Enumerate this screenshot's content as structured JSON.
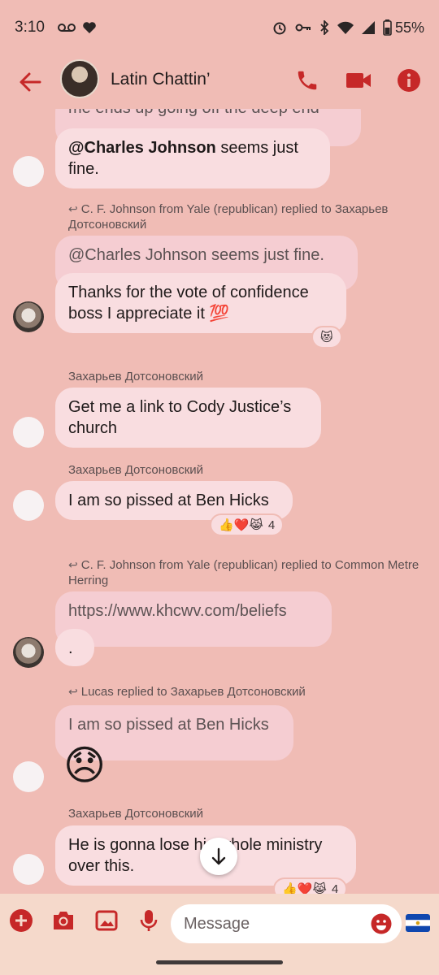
{
  "status": {
    "time": "3:10",
    "battery": "55%",
    "icons": [
      "voicemail-icon",
      "heart-icon",
      "alarm-icon",
      "vpn-key-icon",
      "bluetooth-icon",
      "wifi-icon",
      "signal-icon",
      "battery-icon"
    ]
  },
  "header": {
    "title": "Latin Chattin’",
    "icons": [
      "back-arrow-icon",
      "phone-icon",
      "video-camera-icon",
      "info-icon"
    ],
    "accent": "#c62828"
  },
  "messages": {
    "m1_partial": "me ends up going off the deep end",
    "m2_mention": "@Charles Johnson",
    "m2_rest": " seems just fine.",
    "reply1_label": "C. F. Johnson from Yale (republican) replied to Захарьев Дотсоновский",
    "reply1_quote": "@Charles Johnson  seems just fine.",
    "reply1_text": "Thanks for the vote of confidence boss I appreciate it 💯",
    "reply1_reaction": "😻",
    "sender2": "Захарьев Дотсоновский",
    "m3_text": "Get me a link to Cody Justice’s church",
    "sender3": "Захарьев Дотсоновский",
    "m4_text": "I am so pissed at Ben Hicks",
    "m4_reactions": "👍❤️😹",
    "m4_reaction_count": "4",
    "reply2_label": "C. F. Johnson from Yale (republican) replied to Common Metre Herring",
    "reply2_quote": "https://www.khcwv.com/beliefs",
    "reply2_text": ".",
    "reply3_label": "Lucas replied to Захарьев Дотсоновский",
    "reply3_quote": "I am so pissed at Ben Hicks",
    "reply3_emoji": "😞",
    "sender4": "Захарьев Дотсоновский",
    "m5_text": "He is gonna lose his whole ministry over this.",
    "m5_reactions": "👍❤️😹",
    "m5_reaction_count": "4"
  },
  "compose": {
    "placeholder": "Message",
    "icons": [
      "add-icon",
      "camera-icon",
      "gallery-icon",
      "microphone-icon",
      "emoji-icon",
      "el-salvador-flag-icon"
    ]
  }
}
